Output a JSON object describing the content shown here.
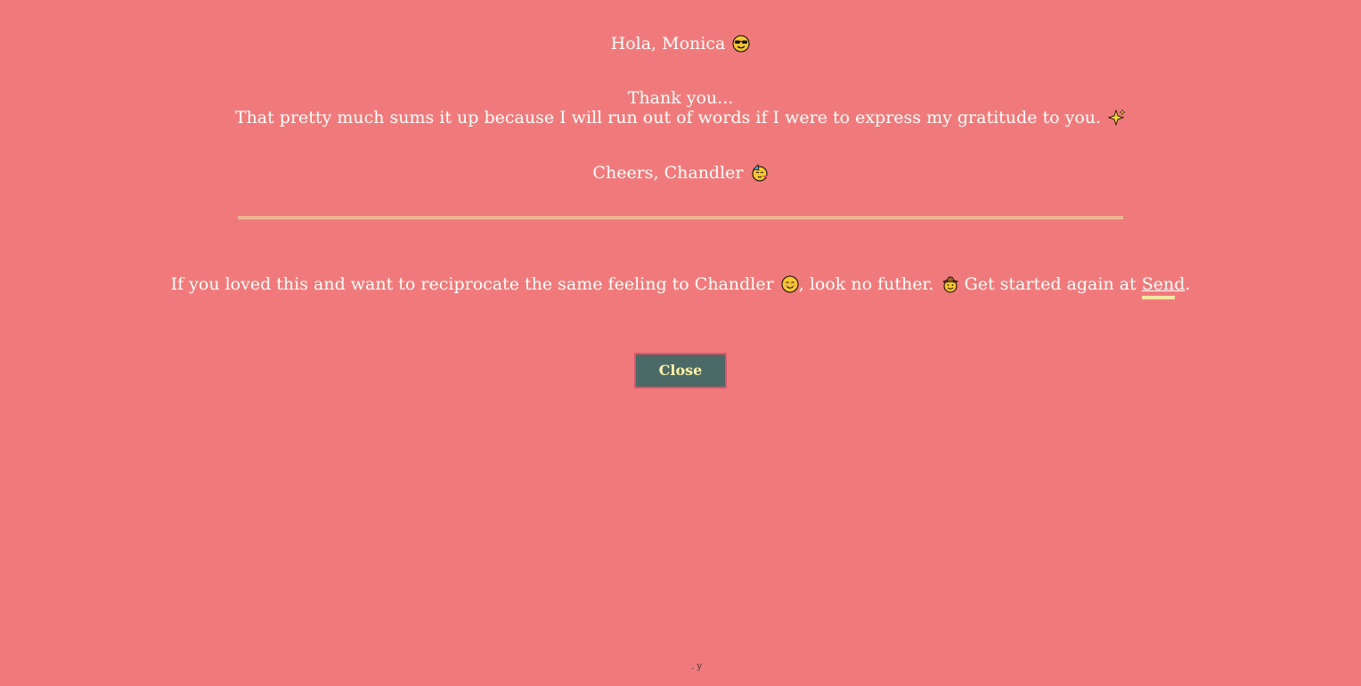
{
  "greeting": {
    "text": "Hola, Monica",
    "icon": "smiling-face-with-sunglasses-icon"
  },
  "message": {
    "line1": "Thank you...",
    "line2": "That pretty much sums it up because I will run out of words if I were to express my gratitude to you.",
    "line2_icon": "sparkles-icon"
  },
  "signoff": {
    "text": "Cheers, Chandler",
    "icon": "partying-face-icon"
  },
  "cta": {
    "part1": "If you loved this and want to reciprocate the same feeling to Chandler",
    "part2": ", look no futher.",
    "part3": " Get started again at ",
    "link_label": "Send",
    "end": ".",
    "icon1": "smiling-face-icon",
    "icon2": "cowboy-face-icon"
  },
  "close_button": {
    "label": "Close"
  },
  "footer": {
    "text": ". y"
  },
  "colors": {
    "background": "#f07a7b",
    "text": "#ffffff",
    "divider": "#f3e3a8",
    "button_bg": "#4b6967",
    "button_text": "#fff4a6",
    "button_border": "#d8566a",
    "link_underline": "#f5e7a3"
  }
}
